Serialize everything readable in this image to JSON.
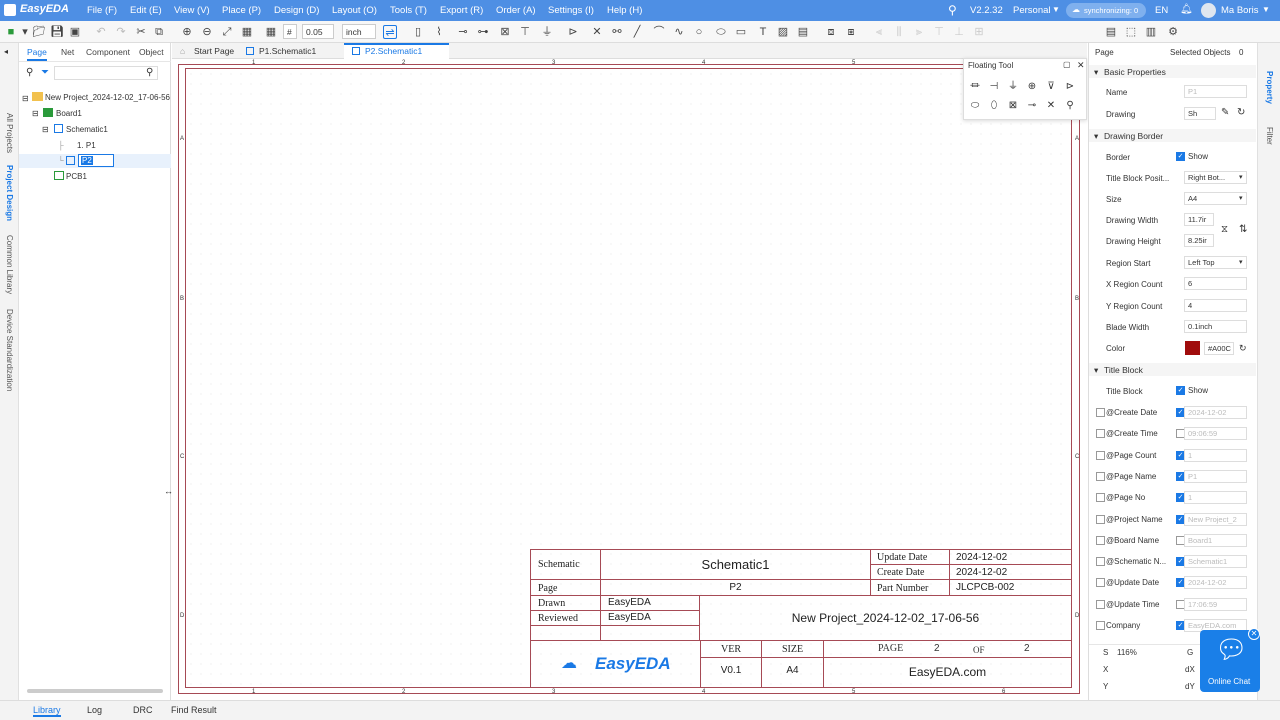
{
  "menubar": {
    "logo": "EasyEDA",
    "items": [
      "File (F)",
      "Edit (E)",
      "View (V)",
      "Place (P)",
      "Design (D)",
      "Layout (O)",
      "Tools (T)",
      "Export (R)",
      "Order (A)",
      "Settings (I)",
      "Help (H)"
    ],
    "version": "V2.2.32",
    "plan": "Personal",
    "sync": "synchronizing: 0",
    "lang": "EN",
    "user": "Ma Boris"
  },
  "toolbar": {
    "grid": "0.05",
    "unit": "inch"
  },
  "left_strip": {
    "tabs": [
      "All Projects",
      "Project Design",
      "Common Library",
      "Device Standardization"
    ]
  },
  "left_panel": {
    "tabs": [
      "Page",
      "Net",
      "Component",
      "Object"
    ],
    "tree": {
      "project": "New Project_2024-12-02_17-06-56",
      "board": "Board1",
      "schematic": "Schematic1",
      "page1": "1. P1",
      "page2_editing": "P2",
      "pcb": "PCB1"
    }
  },
  "doc_tabs": [
    "Start Page",
    "P1.Schematic1",
    "P2.Schematic1"
  ],
  "sheet": {
    "columns": [
      "1",
      "2",
      "3",
      "4",
      "5",
      "6"
    ],
    "rows": [
      "A",
      "B",
      "C",
      "D"
    ]
  },
  "title_block": {
    "schematic_label": "Schematic",
    "schematic_name": "Schematic1",
    "page_label": "Page",
    "page_name": "P2",
    "update_date_label": "Update Date",
    "update_date": "2024-12-02",
    "create_date_label": "Create Date",
    "create_date": "2024-12-02",
    "part_number_label": "Part Number",
    "part_number": "JLCPCB-002",
    "drawn_label": "Drawn",
    "drawn": "EasyEDA",
    "reviewed_label": "Reviewed",
    "reviewed": "EasyEDA",
    "project": "New Project_2024-12-02_17-06-56",
    "ver_label": "VER",
    "ver": "V0.1",
    "size_label": "SIZE",
    "size": "A4",
    "page_no_label": "PAGE",
    "page_no": "2",
    "of_label": "OF",
    "page_count": "2",
    "logo": "EasyEDA",
    "company": "EasyEDA.com"
  },
  "floating_tool": {
    "title": "Floating Tool"
  },
  "right_panel": {
    "header": "Page",
    "selected_label": "Selected Objects",
    "selected_count": "0",
    "basic_section": "Basic Properties",
    "name_label": "Name",
    "name_value": "P1",
    "drawing_label": "Drawing",
    "drawing_value": "Sh",
    "border_section": "Drawing Border",
    "border_label": "Border",
    "show": "Show",
    "title_pos_label": "Title Block Posit...",
    "title_pos_value": "Right Bot...",
    "size_label": "Size",
    "size_value": "A4",
    "width_label": "Drawing Width",
    "width_value": "11.7ir",
    "height_label": "Drawing Height",
    "height_value": "8.25ir",
    "region_start_label": "Region Start",
    "region_start_value": "Left Top",
    "xcount_label": "X Region Count",
    "xcount_value": "6",
    "ycount_label": "Y Region Count",
    "ycount_value": "4",
    "blade_label": "Blade Width",
    "blade_value": "0.1inch",
    "color_label": "Color",
    "color_value": "#A00C",
    "color_swatch": "#a00c0c",
    "title_section": "Title Block",
    "title_block_label": "Title Block",
    "fields": [
      {
        "label": "@Create Date",
        "on": true,
        "value": "2024-12-02"
      },
      {
        "label": "@Create Time",
        "on": false,
        "value": "09:06:59"
      },
      {
        "label": "@Page Count",
        "on": true,
        "value": "1"
      },
      {
        "label": "@Page Name",
        "on": true,
        "value": "P1"
      },
      {
        "label": "@Page No",
        "on": true,
        "value": "1"
      },
      {
        "label": "@Project Name",
        "on": true,
        "value": "New Project_2"
      },
      {
        "label": "@Board Name",
        "on": false,
        "value": "Board1"
      },
      {
        "label": "@Schematic N...",
        "on": true,
        "value": "Schematic1"
      },
      {
        "label": "@Update Date",
        "on": true,
        "value": "2024-12-02"
      },
      {
        "label": "@Update Time",
        "on": false,
        "value": "17:06:59"
      },
      {
        "label": "Company",
        "on": true,
        "value": "EasyEDA.com"
      }
    ],
    "status_s": "S",
    "zoom": "116%",
    "status_g": "G",
    "status_x": "X",
    "status_dx": "dX",
    "status_y": "Y",
    "status_dy": "dY"
  },
  "right_strip": {
    "tabs": [
      "Property",
      "Filter"
    ]
  },
  "chat": {
    "label": "Online Chat"
  },
  "bottom_tabs": [
    "Library",
    "Log",
    "DRC",
    "Find Result"
  ]
}
